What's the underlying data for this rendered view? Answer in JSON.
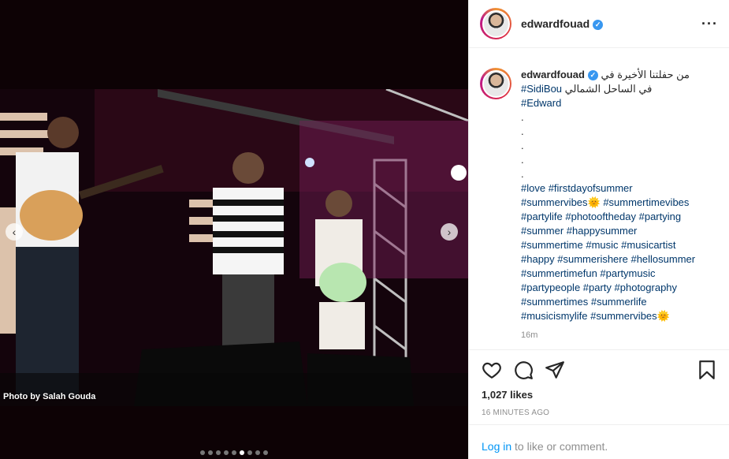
{
  "post": {
    "username": "edwardfouad",
    "verified": true,
    "photo_credit": "Photo by Salah Gouda",
    "carousel": {
      "count": 9,
      "active_index": 5
    }
  },
  "caption": {
    "arabic_line1": "من حفلتنا الأخيرة في",
    "hashtag_sidibou": "#SidiBou",
    "arabic_line2": "في الساحل الشمالي",
    "hashtag_edward": "#Edward",
    "dots": [
      ".",
      ".",
      ".",
      ".",
      "."
    ],
    "hashtag_lines": [
      "#love #firstdayofsummer",
      "#summervibes🌞 #summertimevibes",
      "#partylife #photooftheday #partying",
      "#summer #happysummer",
      "#summertime #music #musicartist",
      "#happy #summerishere #hellosummer",
      "#summertimefun #partymusic",
      "#partypeople #party #photography",
      "#summertimes #summerlife",
      "#musicismylife #summervibes🌞"
    ],
    "time": "16m"
  },
  "actions": {
    "likes": "1,027 likes",
    "posted_ago": "16 MINUTES AGO"
  },
  "login": {
    "link": "Log in",
    "rest": " to like or comment."
  },
  "icons": {
    "like": "heart-icon",
    "comment": "comment-icon",
    "share": "paper-plane-icon",
    "save": "bookmark-icon",
    "more": "more-options-icon",
    "prev": "chevron-left-icon",
    "next": "chevron-right-icon"
  },
  "colors": {
    "link_blue": "#00376b",
    "login_blue": "#0095f6",
    "verified_blue": "#3897f0",
    "muted": "#8e8e8e"
  }
}
